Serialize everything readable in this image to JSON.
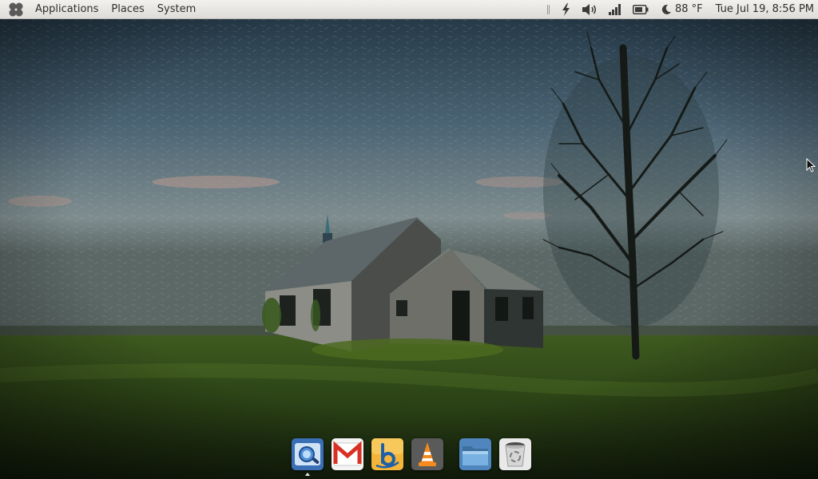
{
  "top_panel": {
    "menus": [
      "Applications",
      "Places",
      "System"
    ],
    "weather": {
      "icon": "moon-icon",
      "temperature": "88 °F"
    },
    "clock": "Tue Jul 19,  8:56 PM",
    "tray_icons": [
      "lightning-icon",
      "volume-icon",
      "signal-icon",
      "battery-icon"
    ]
  },
  "dock": {
    "items": [
      {
        "name": "chromium-browser",
        "icon": "browser-icon",
        "running": true
      },
      {
        "name": "gmail",
        "icon": "gmail-icon",
        "running": false
      },
      {
        "name": "beatbox",
        "icon": "music-player-icon",
        "running": false
      },
      {
        "name": "vlc",
        "icon": "vlc-icon",
        "running": false
      },
      {
        "name": "files",
        "icon": "folder-icon",
        "running": false
      },
      {
        "name": "trash",
        "icon": "trash-icon",
        "running": false
      }
    ]
  },
  "colors": {
    "panel_bg": "#e6e4e0",
    "sky": "#3d5a6c",
    "grass": "#3b5a20",
    "gmail_red": "#d93025",
    "vlc_orange": "#f58b1f",
    "folder_blue": "#5b9bd5"
  }
}
